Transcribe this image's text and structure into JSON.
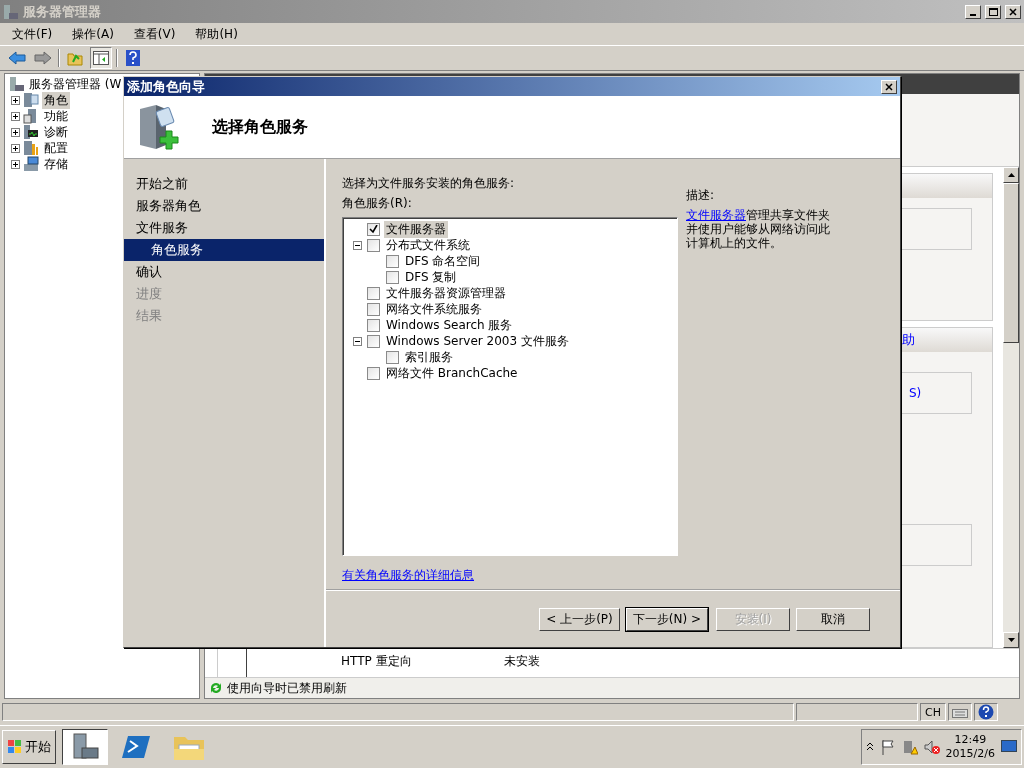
{
  "main_window": {
    "title": "服务器管理器",
    "menu": [
      "文件(F)",
      "操作(A)",
      "查看(V)",
      "帮助(H)"
    ],
    "tree": {
      "root": "服务器管理器 (W",
      "items": [
        {
          "label": "角色",
          "kind": "roles",
          "selected": true,
          "expanded": false
        },
        {
          "label": "功能",
          "kind": "features",
          "selected": false,
          "expanded": false
        },
        {
          "label": "诊断",
          "kind": "diagnostics",
          "selected": false,
          "expanded": false
        },
        {
          "label": "配置",
          "kind": "configuration",
          "selected": false,
          "expanded": false
        },
        {
          "label": "存储",
          "kind": "storage",
          "selected": false,
          "expanded": false
        }
      ]
    },
    "right_pane": {
      "section_headers": [
        "助"
      ],
      "links": [
        "S)"
      ],
      "table_rows": [
        {
          "column_1": "HTTP 重定向",
          "column_2": "未安装"
        }
      ],
      "status": "使用向导时已禁用刷新"
    }
  },
  "status_bar": {
    "language": "CH"
  },
  "dialog": {
    "title": "添加角色向导",
    "heading": "选择角色服务",
    "steps": [
      {
        "label": "开始之前",
        "selected": false,
        "disabled": false
      },
      {
        "label": "服务器角色",
        "selected": false,
        "disabled": false
      },
      {
        "label": "文件服务",
        "selected": false,
        "disabled": false,
        "children": [
          {
            "label": "角色服务",
            "selected": true,
            "disabled": false
          }
        ]
      },
      {
        "label": "确认",
        "selected": false,
        "disabled": false
      },
      {
        "label": "进度",
        "selected": false,
        "disabled": true
      },
      {
        "label": "结果",
        "selected": false,
        "disabled": true
      }
    ],
    "instruction": "选择为文件服务安装的角色服务:",
    "list_label": "角色服务(R):",
    "role_services": [
      {
        "label": "文件服务器",
        "checked": true,
        "selected": true
      },
      {
        "label": "分布式文件系统",
        "checked": false,
        "selected": false,
        "expanded": true,
        "children": [
          {
            "label": "DFS 命名空间",
            "checked": false,
            "selected": false
          },
          {
            "label": "DFS 复制",
            "checked": false,
            "selected": false
          }
        ]
      },
      {
        "label": "文件服务器资源管理器",
        "checked": false,
        "selected": false
      },
      {
        "label": "网络文件系统服务",
        "checked": false,
        "selected": false
      },
      {
        "label": "Windows Search 服务",
        "checked": false,
        "selected": false
      },
      {
        "label": "Windows Server 2003 文件服务",
        "checked": false,
        "selected": false,
        "expanded": true,
        "children": [
          {
            "label": "索引服务",
            "checked": false,
            "selected": false
          }
        ]
      },
      {
        "label": "网络文件 BranchCache",
        "checked": false,
        "selected": false
      }
    ],
    "description": {
      "label": "描述:",
      "link": "文件服务器",
      "text": "管理共享文件夹并使用户能够从网络访问此计算机上的文件。"
    },
    "more_info_link": "有关角色服务的详细信息",
    "buttons": [
      {
        "label": "< 上一步(P)",
        "default": false,
        "disabled": false
      },
      {
        "label": "下一步(N) >",
        "default": true,
        "disabled": false
      },
      {
        "label": "安装(I)",
        "default": false,
        "disabled": true
      },
      {
        "label": "取消",
        "default": false,
        "disabled": false
      }
    ]
  },
  "taskbar": {
    "start": "开始",
    "apps": [
      {
        "kind": "server",
        "selected": true
      },
      {
        "kind": "powershell",
        "selected": false
      },
      {
        "kind": "explorer",
        "selected": false
      }
    ],
    "time": "12:49",
    "date": "2015/2/6"
  }
}
